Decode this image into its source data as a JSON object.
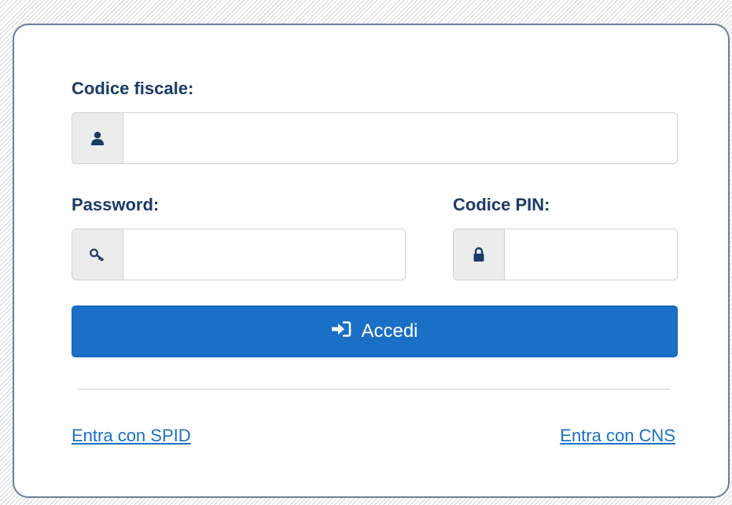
{
  "login_form": {
    "codice_fiscale": {
      "label": "Codice fiscale:",
      "value": "",
      "icon": "user-icon"
    },
    "password": {
      "label": "Password:",
      "value": "",
      "icon": "key-icon"
    },
    "codice_pin": {
      "label": "Codice PIN:",
      "value": "",
      "icon": "lock-icon"
    },
    "submit": {
      "label": "Accedi",
      "icon": "sign-in-icon"
    }
  },
  "alternative_logins": {
    "spid_label": "Entra con SPID",
    "cns_label": "Entra con CNS"
  },
  "colors": {
    "label_text": "#1b3a66",
    "primary_button": "#1a6fc7",
    "link": "#1a6fc7",
    "icon": "#1b3a66",
    "card_border": "#6a7e97"
  }
}
